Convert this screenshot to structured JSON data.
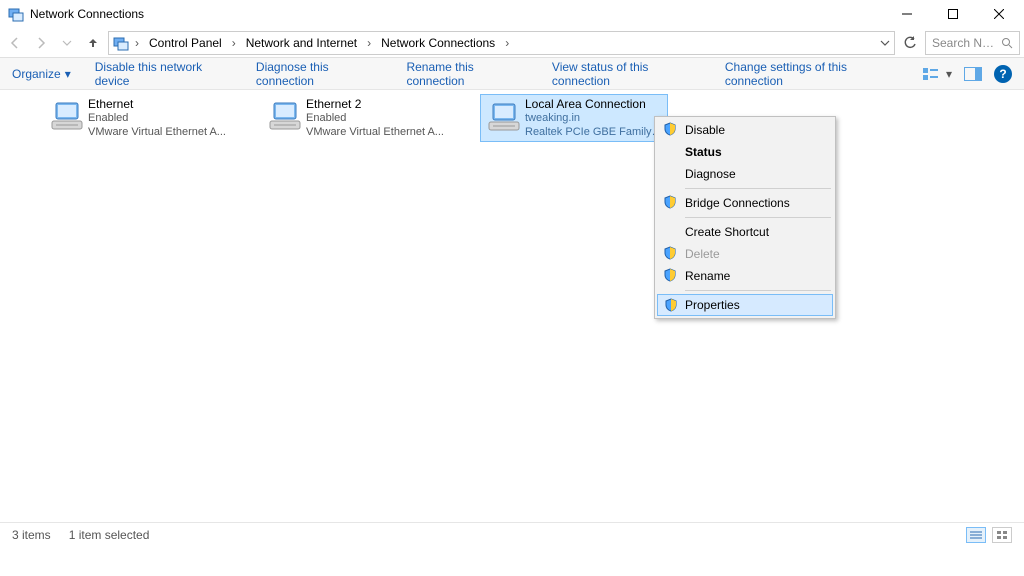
{
  "window": {
    "title": "Network Connections"
  },
  "breadcrumb": {
    "items": [
      "Control Panel",
      "Network and Internet",
      "Network Connections"
    ]
  },
  "search": {
    "placeholder": "Search Ne..."
  },
  "commands": {
    "organize": "Organize",
    "items": [
      "Disable this network device",
      "Diagnose this connection",
      "Rename this connection",
      "View status of this connection",
      "Change settings of this connection"
    ]
  },
  "connections": [
    {
      "name": "Ethernet",
      "status": "Enabled",
      "device": "VMware Virtual Ethernet A...",
      "selected": false
    },
    {
      "name": "Ethernet 2",
      "status": "Enabled",
      "device": "VMware Virtual Ethernet A...",
      "selected": false
    },
    {
      "name": "Local Area Connection",
      "status": "tweaking.in",
      "device": "Realtek PCIe GBE Family C...",
      "selected": true
    }
  ],
  "context_menu": {
    "items": [
      {
        "label": "Disable",
        "shield": true,
        "bold": false,
        "disabled": false,
        "hover": false,
        "sep_after": false
      },
      {
        "label": "Status",
        "shield": false,
        "bold": true,
        "disabled": false,
        "hover": false,
        "sep_after": false
      },
      {
        "label": "Diagnose",
        "shield": false,
        "bold": false,
        "disabled": false,
        "hover": false,
        "sep_after": true
      },
      {
        "label": "Bridge Connections",
        "shield": true,
        "bold": false,
        "disabled": false,
        "hover": false,
        "sep_after": true
      },
      {
        "label": "Create Shortcut",
        "shield": false,
        "bold": false,
        "disabled": false,
        "hover": false,
        "sep_after": false
      },
      {
        "label": "Delete",
        "shield": true,
        "bold": false,
        "disabled": true,
        "hover": false,
        "sep_after": false
      },
      {
        "label": "Rename",
        "shield": true,
        "bold": false,
        "disabled": false,
        "hover": false,
        "sep_after": true
      },
      {
        "label": "Properties",
        "shield": true,
        "bold": false,
        "disabled": false,
        "hover": true,
        "sep_after": false
      }
    ]
  },
  "statusbar": {
    "count": "3 items",
    "selection": "1 item selected"
  }
}
